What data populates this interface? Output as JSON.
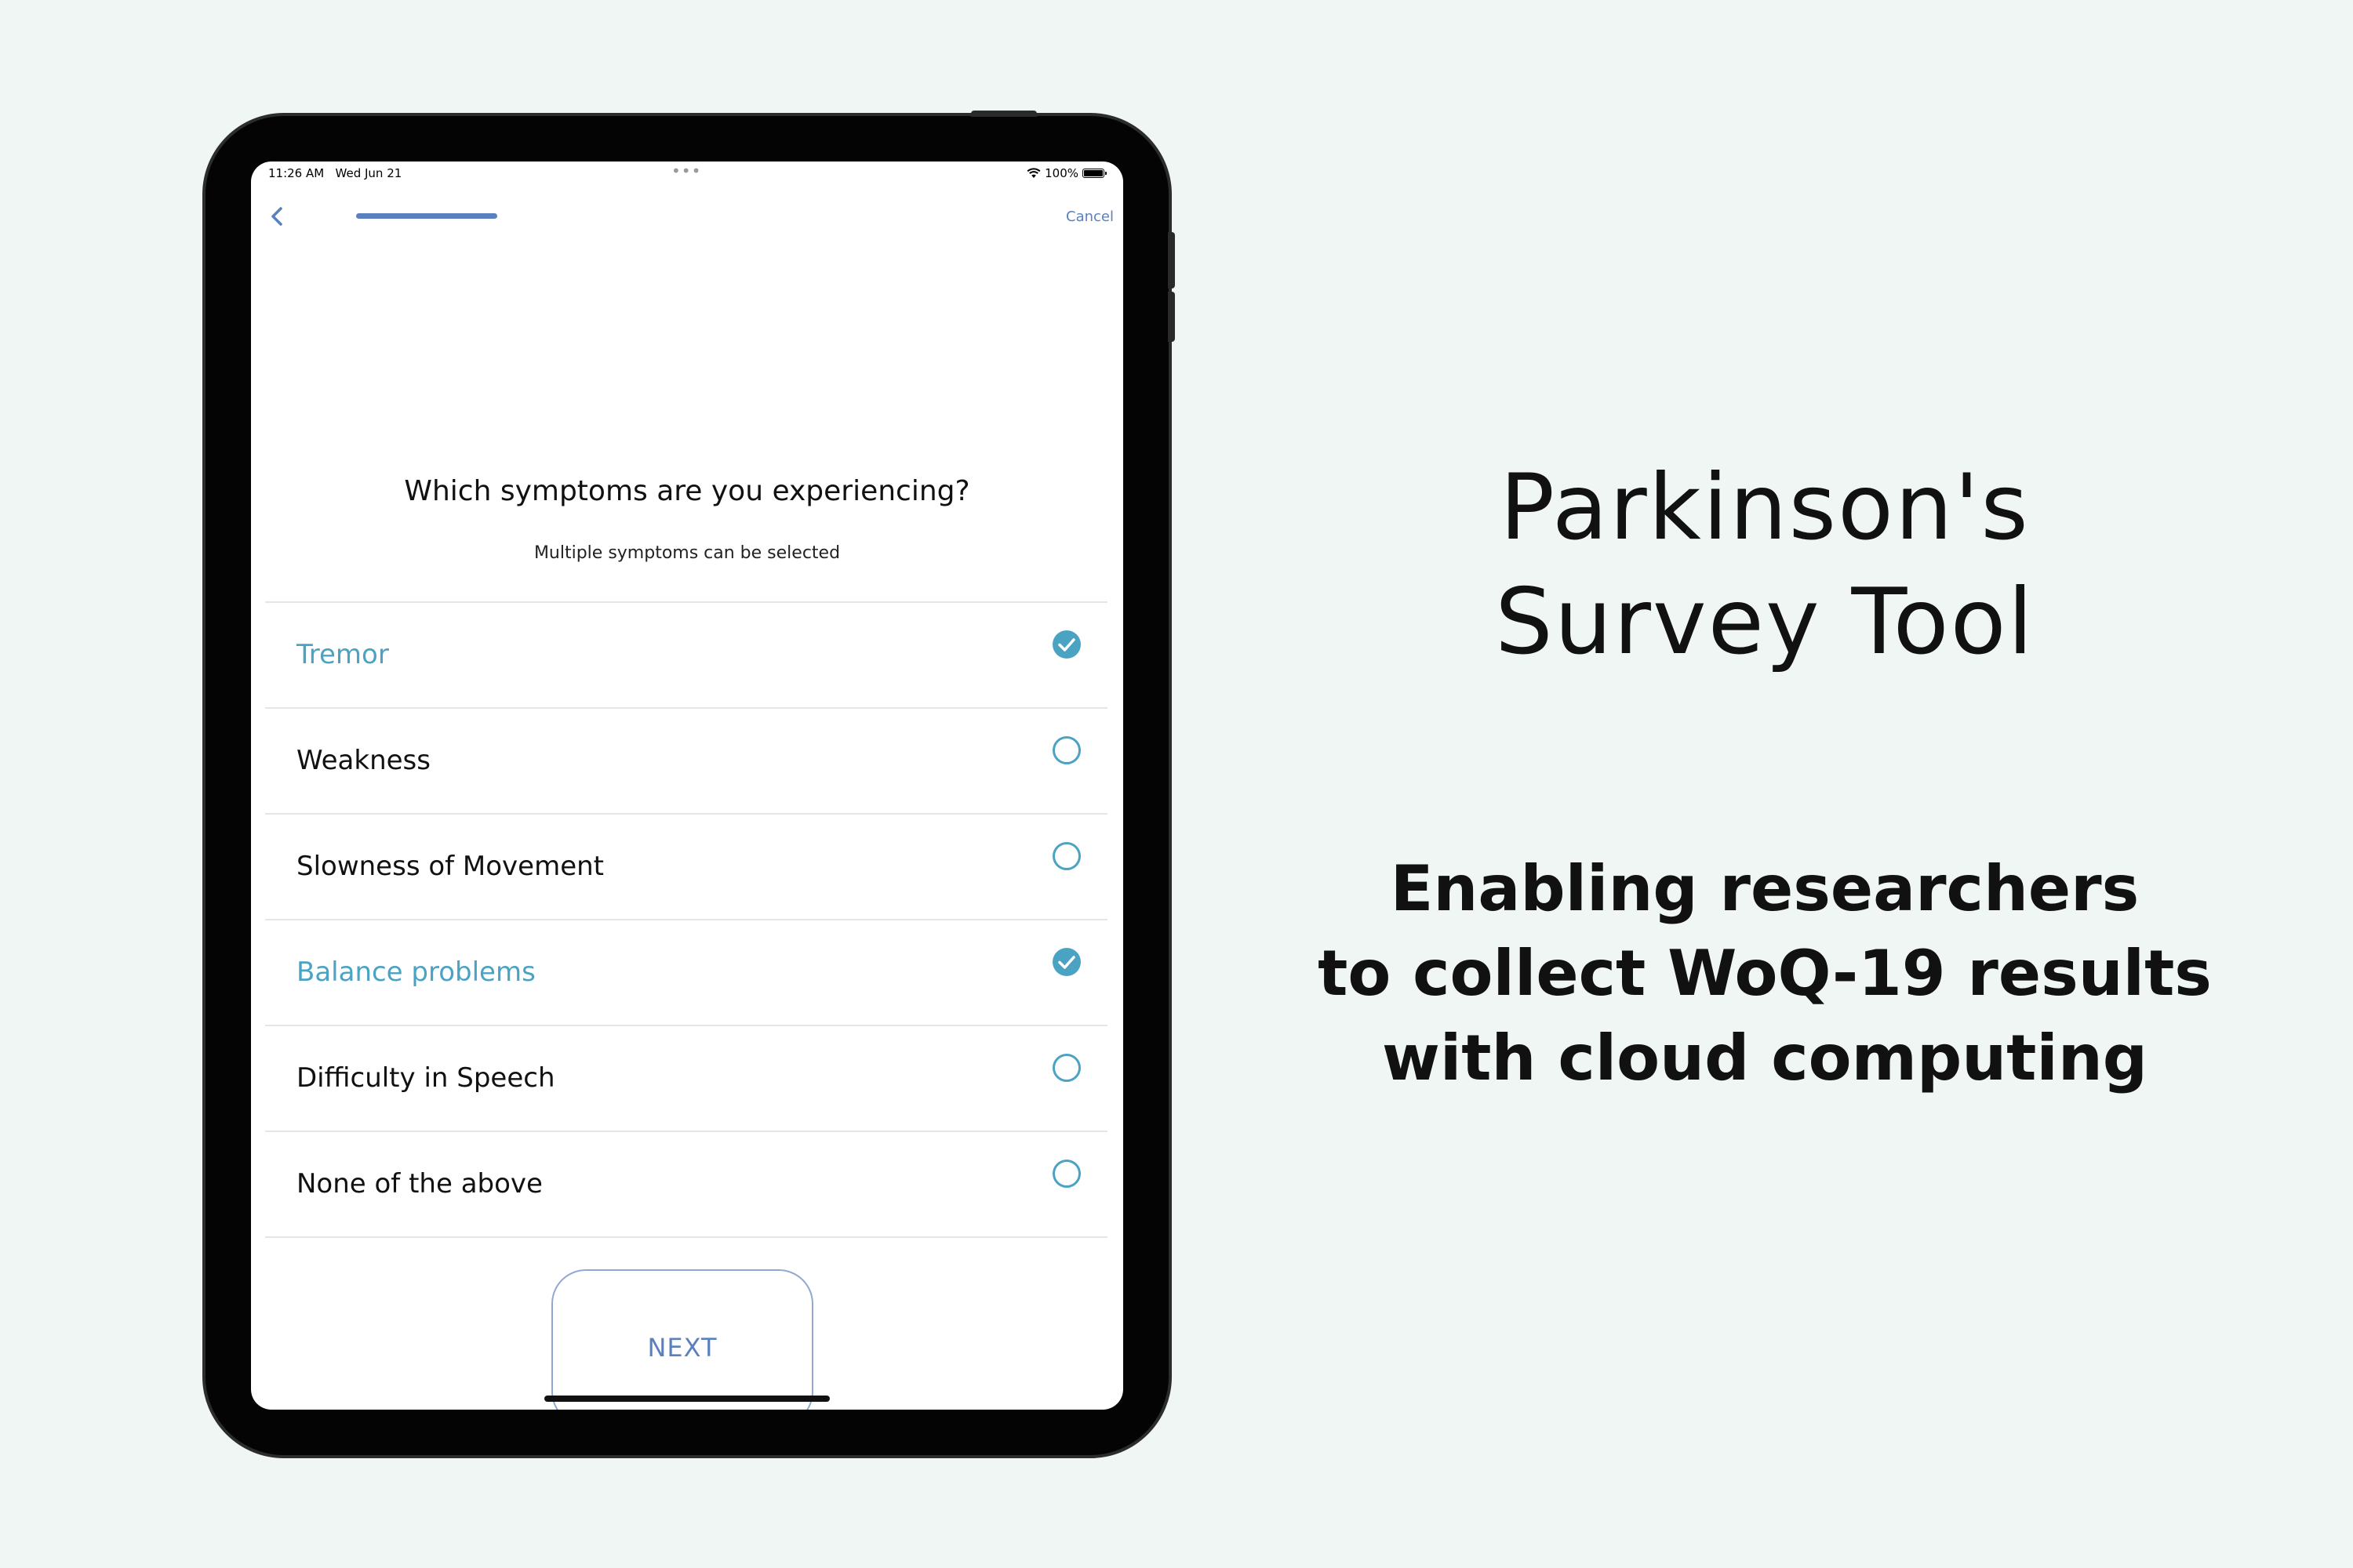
{
  "status_bar": {
    "time": "11:26 AM",
    "date": "Wed Jun 21",
    "battery": "100%",
    "dots": "•••"
  },
  "nav": {
    "back_icon": "chevron-left-icon",
    "cancel_label": "Cancel",
    "progress": 0.4
  },
  "question": {
    "title": "Which symptoms are you experiencing?",
    "subtitle": "Multiple symptoms can be selected"
  },
  "options": [
    {
      "label": "Tremor",
      "selected": true
    },
    {
      "label": "Weakness",
      "selected": false
    },
    {
      "label": "Slowness of Movement",
      "selected": false
    },
    {
      "label": "Balance problems",
      "selected": true
    },
    {
      "label": "Difficulty in Speech",
      "selected": false
    },
    {
      "label": "None of the above",
      "selected": false
    }
  ],
  "next_button_label": "NEXT",
  "promo": {
    "title_line1": "Parkinson's",
    "title_line2": "Survey Tool",
    "tagline_line1": "Enabling researchers",
    "tagline_line2": "to collect WoQ-19 results",
    "tagline_line3": "with cloud computing"
  },
  "colors": {
    "background": "#eff6f4",
    "accent_selected": "#4ba3c3",
    "nav_blue": "#5a80be",
    "device_frame": "#040404"
  }
}
